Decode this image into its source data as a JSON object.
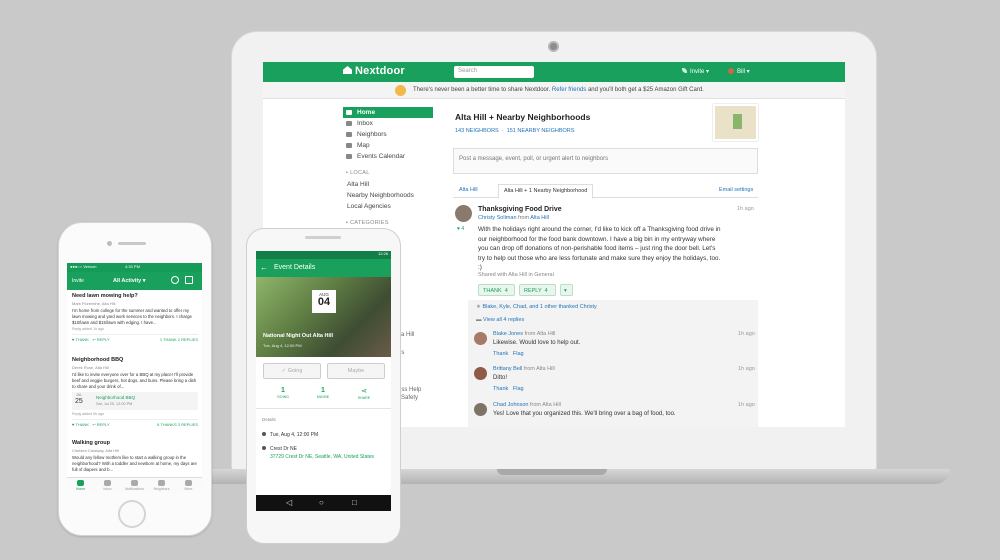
{
  "brand": {
    "name": "Nextdoor",
    "green": "#19a05c",
    "link_blue": "#1f72b8"
  },
  "laptop": {
    "topbar": {
      "search_placeholder": "Search",
      "invite": "Invite ▾",
      "user": "Bill ▾"
    },
    "promo": {
      "text": "There's never been a better time to share Nextdoor.",
      "link": "Refer friends",
      "tail": "and you'll both get a $25 Amazon Gift Card."
    },
    "sidebar": {
      "items": [
        {
          "label": "Home",
          "icon": "home-icon"
        },
        {
          "label": "Inbox",
          "icon": "inbox-icon"
        },
        {
          "label": "Neighbors",
          "icon": "neighbors-icon"
        },
        {
          "label": "Map",
          "icon": "map-icon"
        },
        {
          "label": "Events Calendar",
          "icon": "calendar-icon"
        }
      ],
      "local_heading": "LOCAL",
      "local": [
        "Alta Hill",
        "Nearby Neighborhoods",
        "Local Agencies"
      ],
      "categories_heading": "CATEGORIES",
      "partials": [
        "lta Hill",
        "ds",
        "ess   Help",
        "Safety"
      ]
    },
    "main": {
      "title": "Alta Hill + Nearby Neighborhoods",
      "neighbors_link": "143 NEIGHBORS",
      "nearby_link": "151 NEARBY NEIGHBORS",
      "composer_placeholder": "Post a message, event, poll, or urgent alert to neighbors",
      "tabs": [
        "Alta Hill",
        "Alta Hill + 1 Nearby Neighborhood"
      ],
      "email_settings": "Email settings"
    },
    "post": {
      "title": "Thanksgiving Food Drive",
      "author": "Christy Soliman",
      "from_word": "from",
      "location": "Alta Hill",
      "time": "1h ago",
      "body": "With the holidays right around the corner, I'd like to kick off a Thanksgiving food drive in our neighborhood for the food bank downtown. I have a big bin in my entryway where you can drop off donations of non-perishable food items – just ring the door bell. Let's try to help out those who are less fortunate and make sure they enjoy the holidays, too. :)",
      "shared": "Shared with Alta Hill in General",
      "side_count": "4",
      "thank_btn": "THANK",
      "thank_count": "4",
      "reply_btn": "REPLY",
      "reply_count": "4",
      "more_btn": "▾",
      "thanked_line": "Blake, Kyle, Chad, and 1 other thanked Christy",
      "view_replies": "View all 4 replies"
    },
    "replies": [
      {
        "name": "Blake Jones",
        "from": "from Alta Hill",
        "text": "Likewise. Would love to help out.",
        "time": "1h ago"
      },
      {
        "name": "Brittany Bell",
        "from": "from Alta Hill",
        "text": "Ditto!",
        "time": "1h ago"
      },
      {
        "name": "Chad Johnson",
        "from": "from Alta Hill",
        "text": "Yes! Love that you organized this. We'll bring over a bag of food, too.",
        "time": "1h ago"
      }
    ],
    "reply_actions": {
      "thank": "Thank",
      "flag": "Flag"
    }
  },
  "iphone": {
    "status": {
      "carrier": "●●●○○ Verizon",
      "time": "4:33 PM"
    },
    "bar": {
      "invite": "Invite",
      "title": "All Activity ▾"
    },
    "posts": [
      {
        "title": "Need lawn mowing help?",
        "by": "Mark Florentine, Alta Hill",
        "body": "I'm home from college for the summer and wanted to offer my lawn mowing and yard work services to the neighbors. I charge $10/lawn and $15/lawn with edging. I have...",
        "meta": "Reply added 1h ago",
        "thank": "THANK",
        "reply": "REPLY",
        "counts": "1 THANK  2 REPLIES"
      },
      {
        "title": "Neighborhood BBQ",
        "by": "Derek Rose, Alta Hill",
        "body": "I'd like to invite everyone over for a BBQ at my place! I'll provide beef and veggie burgers, hot dogs, and buns. Please bring a dish to share and your drink of...",
        "event": {
          "month": "JUL",
          "day": "25",
          "title": "Neighborhood BBQ",
          "when": "Sat, Jul 25, 12:00 PM"
        },
        "meta": "Reply added 5h ago",
        "thank": "THANK",
        "reply": "REPLY",
        "counts": "6 THANKS  3 REPLIES"
      },
      {
        "title": "Walking group",
        "by": "Chelsea Caraway, Alta Hill",
        "body": "Would any fellow mothers like to start a walking group in the neighborhood? With a toddler and newborn at home, my days are full of diapers and b..."
      }
    ],
    "tabs": [
      "Home",
      "Inbox",
      "Notifications",
      "Neighbors",
      "More"
    ]
  },
  "android": {
    "status_time": "12:26",
    "title": "Event Details",
    "date": {
      "month": "AUG",
      "day": "04"
    },
    "event_title": "National Night Out Alta Hill",
    "event_sub": "Tue, Aug 4, 12:00 PM",
    "going_btn": "Going",
    "maybe_btn": "Maybe",
    "counts": [
      {
        "value": "1",
        "label": "GOING"
      },
      {
        "value": "1",
        "label": "MAYBE"
      },
      {
        "value": "",
        "label": "SHARE"
      }
    ],
    "details_heading": "Details",
    "when": "Tue, Aug 4, 12:00 PM",
    "where_title": "Crest Dr NE",
    "where_address": "37729 Crest Dr NE, Seattle, WA, United States",
    "nav": [
      "◁",
      "○",
      "□"
    ]
  }
}
